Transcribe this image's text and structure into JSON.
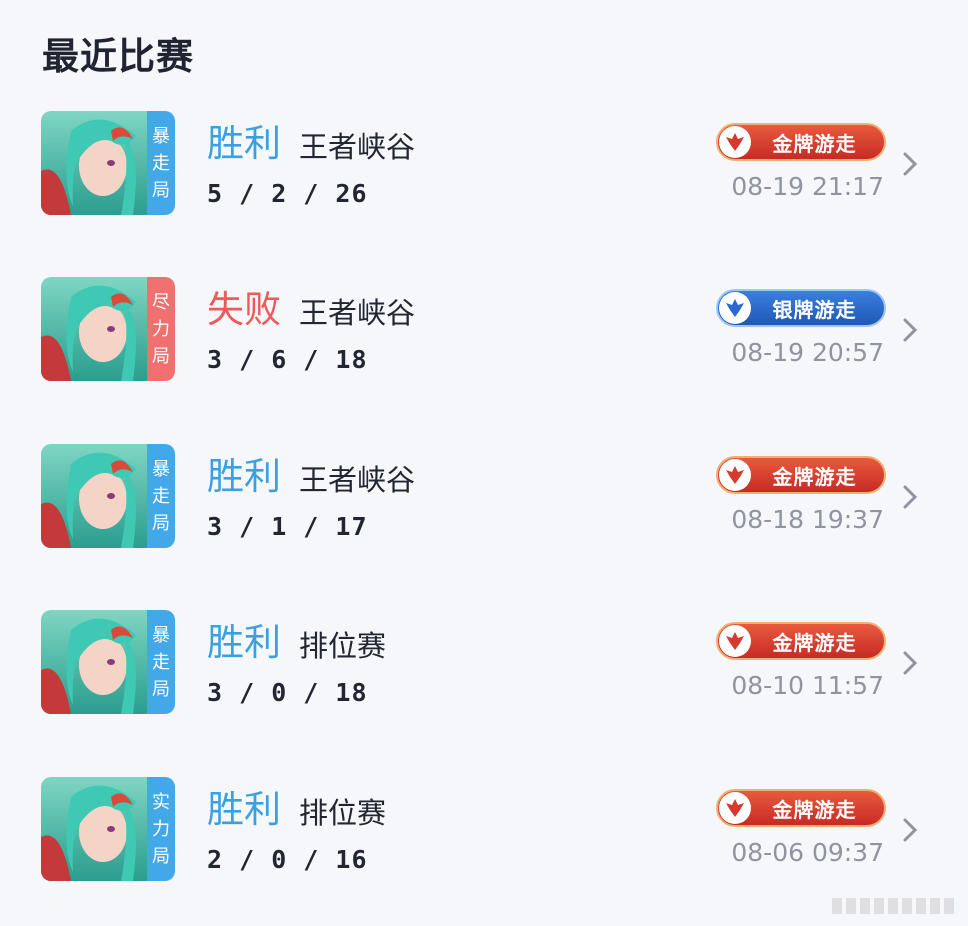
{
  "page": {
    "title": "最近比赛"
  },
  "matches": [
    {
      "mode_tag": [
        "暴",
        "走",
        "局"
      ],
      "tag_color": "#43a8ea",
      "result": "胜利",
      "result_type": "win",
      "map": "王者峡谷",
      "kda": "5 / 2 / 26",
      "badge": "金牌游走",
      "badge_type": "gold",
      "datetime": "08-19 21:17"
    },
    {
      "mode_tag": [
        "尽",
        "力",
        "局"
      ],
      "tag_color": "#f0706f",
      "result": "失败",
      "result_type": "lose",
      "map": "王者峡谷",
      "kda": "3 / 6 / 18",
      "badge": "银牌游走",
      "badge_type": "silver",
      "datetime": "08-19 20:57"
    },
    {
      "mode_tag": [
        "暴",
        "走",
        "局"
      ],
      "tag_color": "#43a8ea",
      "result": "胜利",
      "result_type": "win",
      "map": "王者峡谷",
      "kda": "3 / 1 / 17",
      "badge": "金牌游走",
      "badge_type": "gold",
      "datetime": "08-18 19:37"
    },
    {
      "mode_tag": [
        "暴",
        "走",
        "局"
      ],
      "tag_color": "#43a8ea",
      "result": "胜利",
      "result_type": "win",
      "map": "排位赛",
      "kda": "3 / 0 / 18",
      "badge": "金牌游走",
      "badge_type": "gold",
      "datetime": "08-10 11:57"
    },
    {
      "mode_tag": [
        "实",
        "力",
        "局"
      ],
      "tag_color": "#43a8ea",
      "result": "胜利",
      "result_type": "win",
      "map": "排位赛",
      "kda": "2 / 0 / 16",
      "badge": "金牌游走",
      "badge_type": "gold",
      "datetime": "08-06 09:37"
    }
  ],
  "colors": {
    "win": "#3ba0e0",
    "lose": "#ef5959",
    "badge_gold": "#d63a2e",
    "badge_silver": "#2a6ad0"
  },
  "icons": {
    "row_arrow": "chevron-right-icon",
    "badge": "rank-emblem-icon"
  }
}
